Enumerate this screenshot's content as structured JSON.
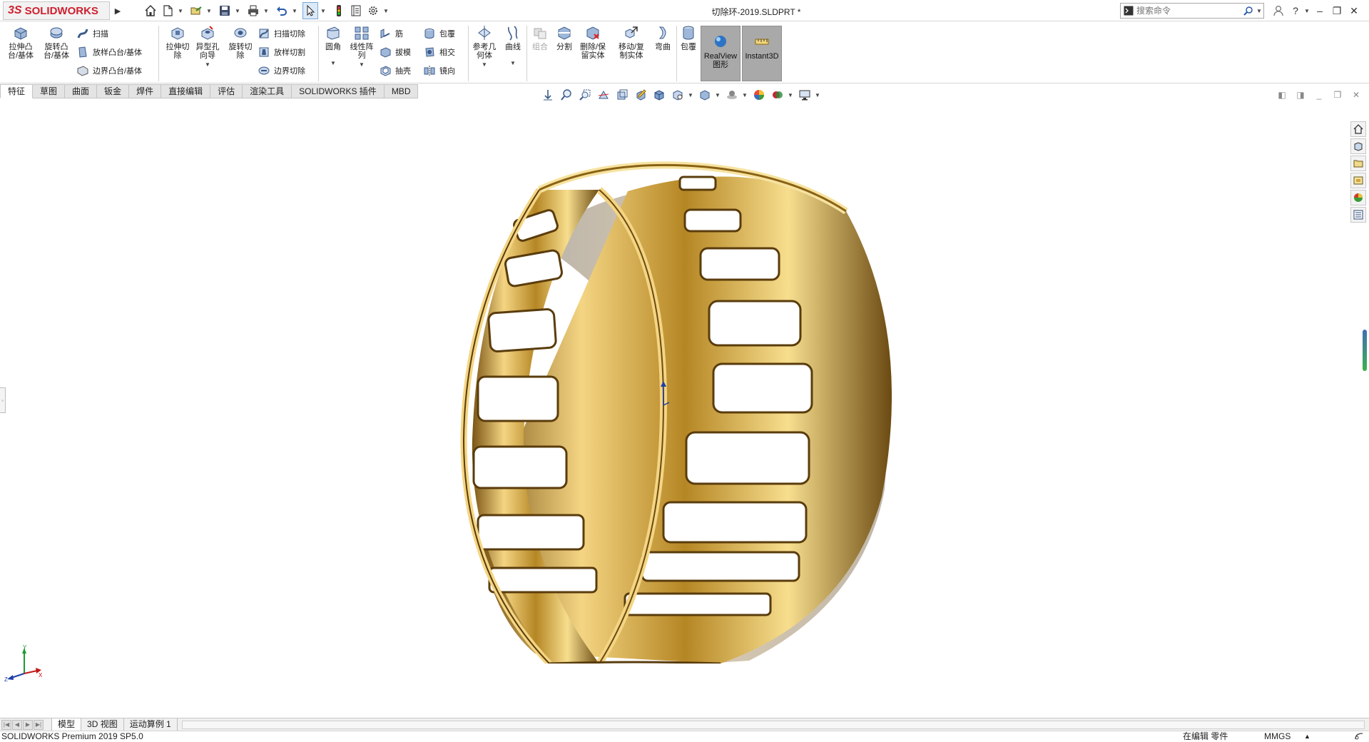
{
  "app": {
    "logo_ds": "3S",
    "logo_text": "SOLIDWORKS",
    "document_title": "切除环-2019.SLDPRT *"
  },
  "search": {
    "placeholder": "搜索命令"
  },
  "ribbon": {
    "extrude_boss": "拉伸凸\n台/基体",
    "revolve_boss": "旋转凸\n台/基体",
    "sweep": "扫描",
    "loft_boss": "放样凸台/基体",
    "boundary_boss": "边界凸台/基体",
    "extrude_cut": "拉伸切\n除",
    "hole_wizard": "异型孔\n向导",
    "revolve_cut": "旋转切\n除",
    "sweep_cut": "扫描切除",
    "loft_cut": "放样切割",
    "boundary_cut": "边界切除",
    "fillet": "圆角",
    "linear_pattern": "线性阵\n列",
    "rib": "筋",
    "draft": "拔模",
    "shell": "抽壳",
    "wrap": "包覆",
    "intersect": "相交",
    "mirror": "镜向",
    "ref_geometry": "参考几\n何体",
    "curves": "曲线",
    "combine": "组合",
    "split": "分割",
    "delete_body": "删除/保\n留实体",
    "move_copy": "移动/复\n制实体",
    "flex": "弯曲",
    "wrap2": "包覆",
    "realview": "RealView\n图形",
    "instant3d": "Instant3D"
  },
  "tabs": [
    {
      "label": "特征"
    },
    {
      "label": "草图"
    },
    {
      "label": "曲面"
    },
    {
      "label": "钣金"
    },
    {
      "label": "焊件"
    },
    {
      "label": "直接编辑"
    },
    {
      "label": "评估"
    },
    {
      "label": "渲染工具"
    },
    {
      "label": "SOLIDWORKS 插件"
    },
    {
      "label": "MBD"
    }
  ],
  "bottom_tabs": [
    {
      "label": "模型"
    },
    {
      "label": "3D 视图"
    },
    {
      "label": "运动算例 1"
    }
  ],
  "status": {
    "version": "SOLIDWORKS Premium 2019 SP5.0",
    "editing": "在编辑 零件",
    "units": "MMGS",
    "units_dropdown": "▲"
  },
  "icons": {
    "home": "home-icon",
    "new": "new-document-icon",
    "open": "open-icon",
    "save": "save-icon",
    "print": "print-icon",
    "undo": "undo-icon",
    "select": "select-arrow-icon",
    "rebuild": "traffic-light-icon",
    "file_properties": "file-properties-icon",
    "options": "gear-icon"
  },
  "colors": {
    "brand_red": "#cf1f2e",
    "gold_light": "#f7dd8a",
    "gold_mid": "#c99a2e",
    "gold_dark": "#6b4a12",
    "toggle_active": "#a9a9a9"
  }
}
